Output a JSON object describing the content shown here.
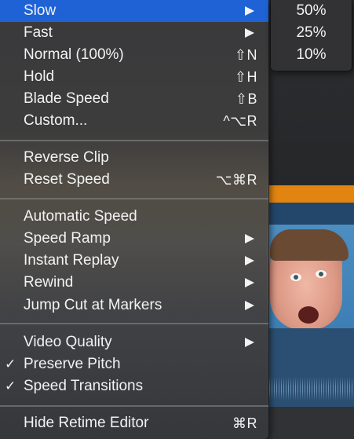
{
  "menu": {
    "items": [
      {
        "label": "Slow",
        "shortcut": "",
        "submenu": true,
        "checked": false,
        "selected": true
      },
      {
        "label": "Fast",
        "shortcut": "",
        "submenu": true,
        "checked": false,
        "selected": false
      },
      {
        "label": "Normal (100%)",
        "shortcut": "⇧N",
        "submenu": false,
        "checked": false,
        "selected": false
      },
      {
        "label": "Hold",
        "shortcut": "⇧H",
        "submenu": false,
        "checked": false,
        "selected": false
      },
      {
        "label": "Blade Speed",
        "shortcut": "⇧B",
        "submenu": false,
        "checked": false,
        "selected": false
      },
      {
        "label": "Custom...",
        "shortcut": "^⌥R",
        "submenu": false,
        "checked": false,
        "selected": false
      },
      {
        "label": "Reverse Clip",
        "shortcut": "",
        "submenu": false,
        "checked": false,
        "selected": false
      },
      {
        "label": "Reset Speed",
        "shortcut": "⌥⌘R",
        "submenu": false,
        "checked": false,
        "selected": false
      },
      {
        "label": "Automatic Speed",
        "shortcut": "",
        "submenu": false,
        "checked": false,
        "selected": false
      },
      {
        "label": "Speed Ramp",
        "shortcut": "",
        "submenu": true,
        "checked": false,
        "selected": false
      },
      {
        "label": "Instant Replay",
        "shortcut": "",
        "submenu": true,
        "checked": false,
        "selected": false
      },
      {
        "label": "Rewind",
        "shortcut": "",
        "submenu": true,
        "checked": false,
        "selected": false
      },
      {
        "label": "Jump Cut at Markers",
        "shortcut": "",
        "submenu": true,
        "checked": false,
        "selected": false
      },
      {
        "label": "Video Quality",
        "shortcut": "",
        "submenu": true,
        "checked": false,
        "selected": false
      },
      {
        "label": "Preserve Pitch",
        "shortcut": "",
        "submenu": false,
        "checked": true,
        "selected": false
      },
      {
        "label": "Speed Transitions",
        "shortcut": "",
        "submenu": false,
        "checked": true,
        "selected": false
      },
      {
        "label": "Hide Retime Editor",
        "shortcut": "⌘R",
        "submenu": false,
        "checked": false,
        "selected": false
      }
    ],
    "check_glyph": "✓"
  },
  "submenu": {
    "items": [
      "50%",
      "25%",
      "10%"
    ]
  },
  "colors": {
    "selection": "#1e62d6",
    "timeline_orange": "#e28410",
    "timeline_blue": "#23466b"
  }
}
